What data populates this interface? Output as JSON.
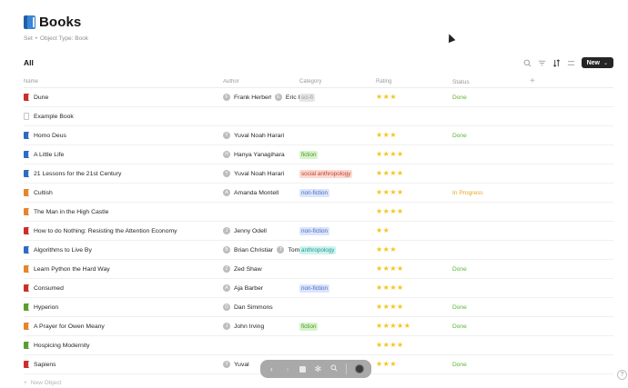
{
  "header": {
    "title": "Books",
    "breadcrumb_type": "Set",
    "breadcrumb_sep": "•",
    "breadcrumb_object": "Object Type: Book"
  },
  "view": {
    "name": "All",
    "new_label": "New",
    "icons": [
      "search-icon",
      "filter-icon",
      "sort-icon",
      "settings-icon"
    ]
  },
  "columns": {
    "name": "Name",
    "author": "Author",
    "category": "Category",
    "rating": "Rating",
    "status": "Status"
  },
  "colors": {
    "done": "#5db431",
    "in_progress": "#e6a521",
    "star": "#f3c51b",
    "new_button": "#252525"
  },
  "rows": [
    {
      "name": "Dune",
      "book_color": "red",
      "authors": [
        {
          "initial": "F",
          "name": "Frank Herbert"
        },
        {
          "initial": "E",
          "name": "Eric I"
        }
      ],
      "category": "sci-fi",
      "category_color": "gray",
      "rating": 3,
      "status": "Done"
    },
    {
      "name": "Example Book",
      "book_color": "img",
      "authors": [],
      "category": "",
      "category_color": "",
      "rating": 0,
      "status": ""
    },
    {
      "name": "Homo Deus",
      "book_color": "blue",
      "authors": [
        {
          "initial": "Y",
          "name": "Yuval Noah Harari"
        }
      ],
      "category": "",
      "category_color": "",
      "rating": 3,
      "status": "Done"
    },
    {
      "name": "A Little Life",
      "book_color": "blue",
      "authors": [
        {
          "initial": "H",
          "name": "Hanya Yanagihara"
        }
      ],
      "category": "fiction",
      "category_color": "green",
      "rating": 4,
      "status": ""
    },
    {
      "name": "21 Lessons for the 21st Century",
      "book_color": "blue",
      "authors": [
        {
          "initial": "Y",
          "name": "Yuval Noah Harari"
        }
      ],
      "category": "social anthropology",
      "category_color": "red",
      "rating": 4,
      "status": ""
    },
    {
      "name": "Cultish",
      "book_color": "orange",
      "authors": [
        {
          "initial": "A",
          "name": "Amanda Montell"
        }
      ],
      "category": "non-fiction",
      "category_color": "blue",
      "rating": 4,
      "status": "In Progress"
    },
    {
      "name": "The Man in the High Castle",
      "book_color": "orange",
      "authors": [],
      "category": "",
      "category_color": "",
      "rating": 4,
      "status": ""
    },
    {
      "name": "How to do Nothing: Resisting the Attention Economy",
      "book_color": "red",
      "authors": [
        {
          "initial": "J",
          "name": "Jenny Odell"
        }
      ],
      "category": "non-fiction",
      "category_color": "blue",
      "rating": 2,
      "status": ""
    },
    {
      "name": "Algorithms to Live By",
      "book_color": "blue",
      "authors": [
        {
          "initial": "B",
          "name": "Brian Christian"
        },
        {
          "initial": "T",
          "name": "Tom"
        }
      ],
      "category": "anthropology",
      "category_color": "teal",
      "rating": 3,
      "status": ""
    },
    {
      "name": "Learn Python the Hard Way",
      "book_color": "orange",
      "authors": [
        {
          "initial": "Z",
          "name": "Zed Shaw"
        }
      ],
      "category": "",
      "category_color": "",
      "rating": 4,
      "status": "Done"
    },
    {
      "name": "Consumed",
      "book_color": "red",
      "authors": [
        {
          "initial": "A",
          "name": "Aja Barber"
        }
      ],
      "category": "non-fiction",
      "category_color": "blue",
      "rating": 4,
      "status": ""
    },
    {
      "name": "Hyperion",
      "book_color": "green",
      "authors": [
        {
          "initial": "D",
          "name": "Dan Simmons"
        }
      ],
      "category": "",
      "category_color": "",
      "rating": 4,
      "status": "Done"
    },
    {
      "name": "A Prayer for Owen Meany",
      "book_color": "orange",
      "authors": [
        {
          "initial": "J",
          "name": "John Irving"
        }
      ],
      "category": "fiction",
      "category_color": "green",
      "rating": 5,
      "status": "Done"
    },
    {
      "name": "Hospicing Modernity",
      "book_color": "green",
      "authors": [],
      "category": "",
      "category_color": "",
      "rating": 4,
      "status": ""
    },
    {
      "name": "Sapiens",
      "book_color": "red",
      "authors": [
        {
          "initial": "Y",
          "name": "Yuval"
        }
      ],
      "category": "",
      "category_color": "",
      "rating": 3,
      "status": "Done"
    }
  ],
  "footer": {
    "new_object_label": "New Object",
    "help_label": "?"
  }
}
